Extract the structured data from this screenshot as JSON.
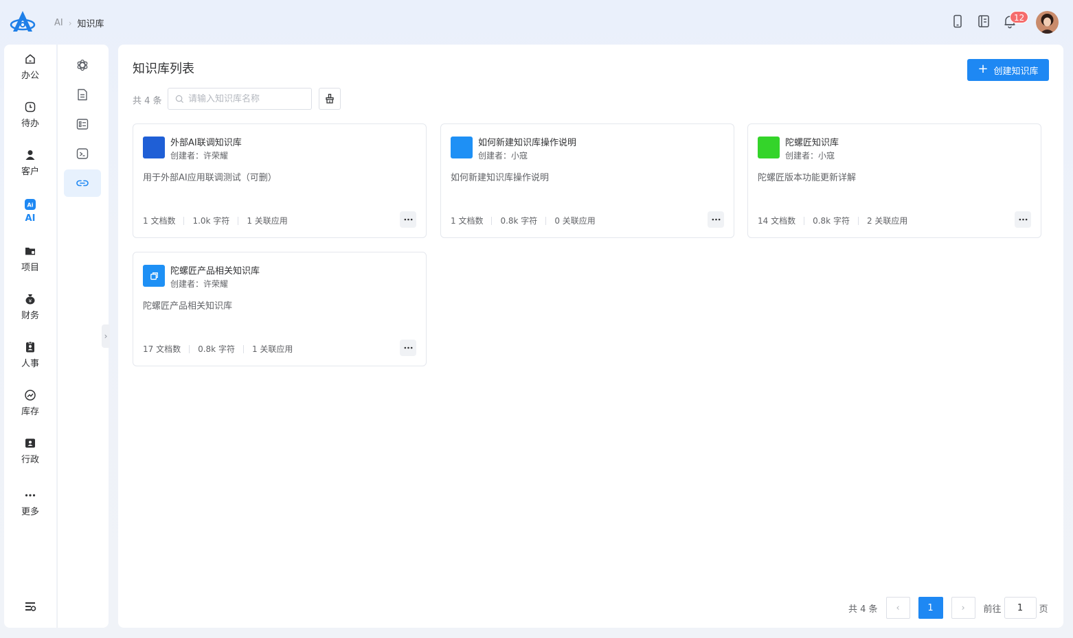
{
  "breadcrumb": {
    "root": "AI",
    "current": "知识库"
  },
  "notifications": {
    "count": "12"
  },
  "sidebar": {
    "items": [
      {
        "label": "办公",
        "icon": "home-icon"
      },
      {
        "label": "待办",
        "icon": "clock-icon"
      },
      {
        "label": "客户",
        "icon": "customer-icon"
      },
      {
        "label": "AI",
        "icon": "ai-icon",
        "active": true
      },
      {
        "label": "项目",
        "icon": "folder-icon"
      },
      {
        "label": "财务",
        "icon": "money-bag-icon"
      },
      {
        "label": "人事",
        "icon": "badge-icon"
      },
      {
        "label": "库存",
        "icon": "trend-icon"
      },
      {
        "label": "行政",
        "icon": "id-card-icon"
      },
      {
        "label": "更多",
        "icon": "more-dots-icon"
      }
    ]
  },
  "subnav": {
    "items": [
      {
        "icon": "openai-icon"
      },
      {
        "icon": "document-icon"
      },
      {
        "icon": "checklist-icon"
      },
      {
        "icon": "terminal-icon"
      },
      {
        "icon": "link-icon",
        "active": true
      }
    ]
  },
  "main": {
    "title": "知识库列表",
    "create_label": "创建知识库",
    "total": "共 4 条",
    "search_placeholder": "请输入知识库名称"
  },
  "cards": [
    {
      "title": "外部AI联调知识库",
      "creator": "创建者：许荣耀",
      "desc": "用于外部AI应用联调测试（可删）",
      "docs": "1 文档数",
      "chars": "1.0k 字符",
      "apps": "1 关联应用",
      "color": "#1f5fd6"
    },
    {
      "title": "如何新建知识库操作说明",
      "creator": "创建者：小寇",
      "desc": "如何新建知识库操作说明",
      "docs": "1 文档数",
      "chars": "0.8k 字符",
      "apps": "0 关联应用",
      "color": "#1e90f5"
    },
    {
      "title": "陀螺匠知识库",
      "creator": "创建者：小寇",
      "desc": "陀螺匠版本功能更新详解",
      "docs": "14 文档数",
      "chars": "0.8k 字符",
      "apps": "2 关联应用",
      "color": "#34d42a"
    },
    {
      "title": "陀螺匠产品相关知识库",
      "creator": "创建者：许荣耀",
      "desc": "陀螺匠产品相关知识库",
      "docs": "17 文档数",
      "chars": "0.8k 字符",
      "apps": "1 关联应用",
      "color": "#1e90f5"
    }
  ],
  "pagination": {
    "total": "共 4 条",
    "current": "1",
    "goto_label": "前往",
    "goto_value": "1",
    "suffix": "页"
  }
}
